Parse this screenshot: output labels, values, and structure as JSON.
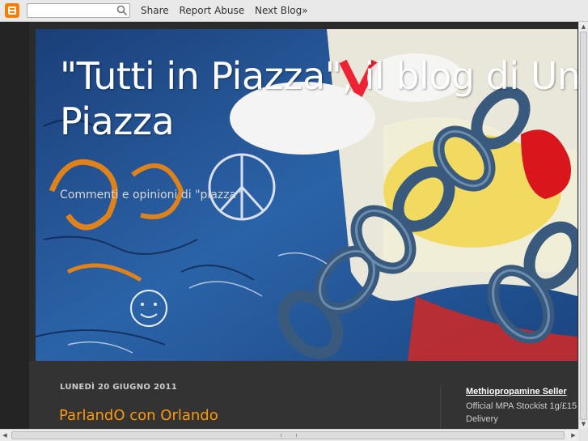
{
  "navbar": {
    "share": "Share",
    "report_abuse": "Report Abuse",
    "next_blog": "Next Blog»",
    "search_placeholder": ""
  },
  "header": {
    "title": "\"Tutti in Piazza\", il blog di Uni\nPiazza",
    "description": "Commenti e opinioni di \"piazza\""
  },
  "post": {
    "date": "LUNEDÌ 20 GIUGNO 2011",
    "title": "ParlandO con Orlando"
  },
  "sidebar": {
    "title": "Methiopropamine Seller",
    "line1": "Official MPA Stockist 1g/£15",
    "line2": "Delivery"
  },
  "colors": {
    "background": "#2b2b2b",
    "post_title": "#ff9900",
    "navbar": "#e9e9e9",
    "blogger_orange": "#f57d00"
  }
}
